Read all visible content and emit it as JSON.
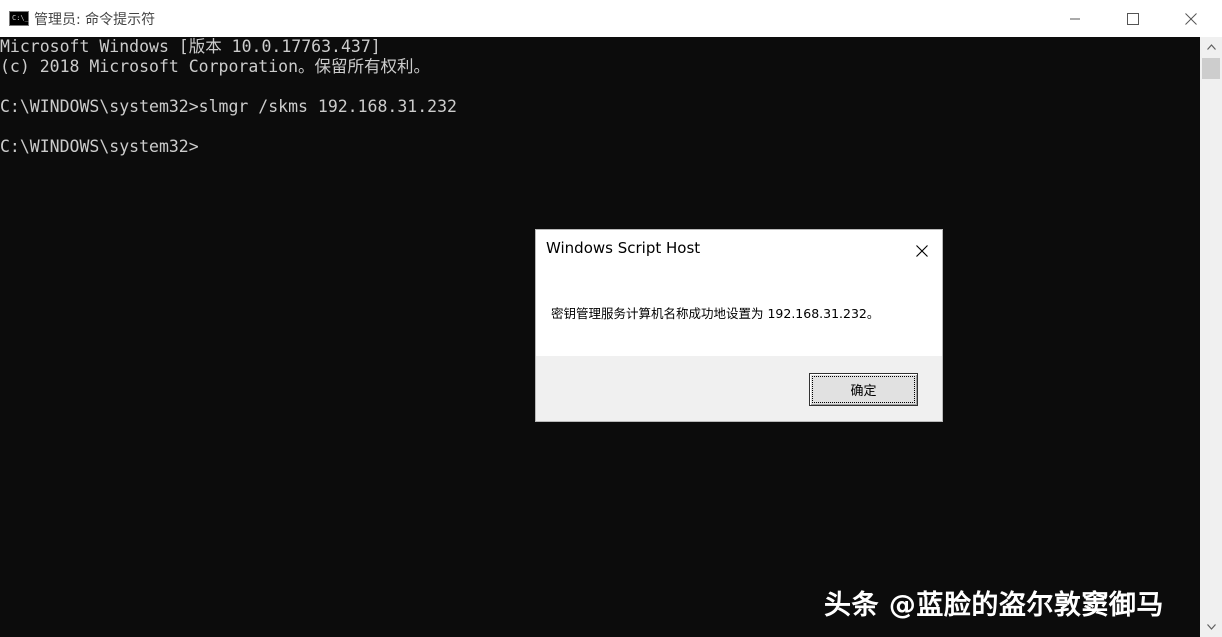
{
  "window": {
    "title": "管理员: 命令提示符",
    "icon_text": "C:\\_"
  },
  "console": {
    "lines": [
      "Microsoft Windows [版本 10.0.17763.437]",
      "(c) 2018 Microsoft Corporation。保留所有权利。",
      "",
      "C:\\WINDOWS\\system32>slmgr /skms 192.168.31.232",
      "",
      "C:\\WINDOWS\\system32>"
    ]
  },
  "dialog": {
    "title": "Windows Script Host",
    "message": "密钥管理服务计算机名称成功地设置为 192.168.31.232。",
    "ok_label": "确定"
  },
  "watermark": {
    "text": "头条 @蓝脸的盗尔敦窦御马"
  }
}
